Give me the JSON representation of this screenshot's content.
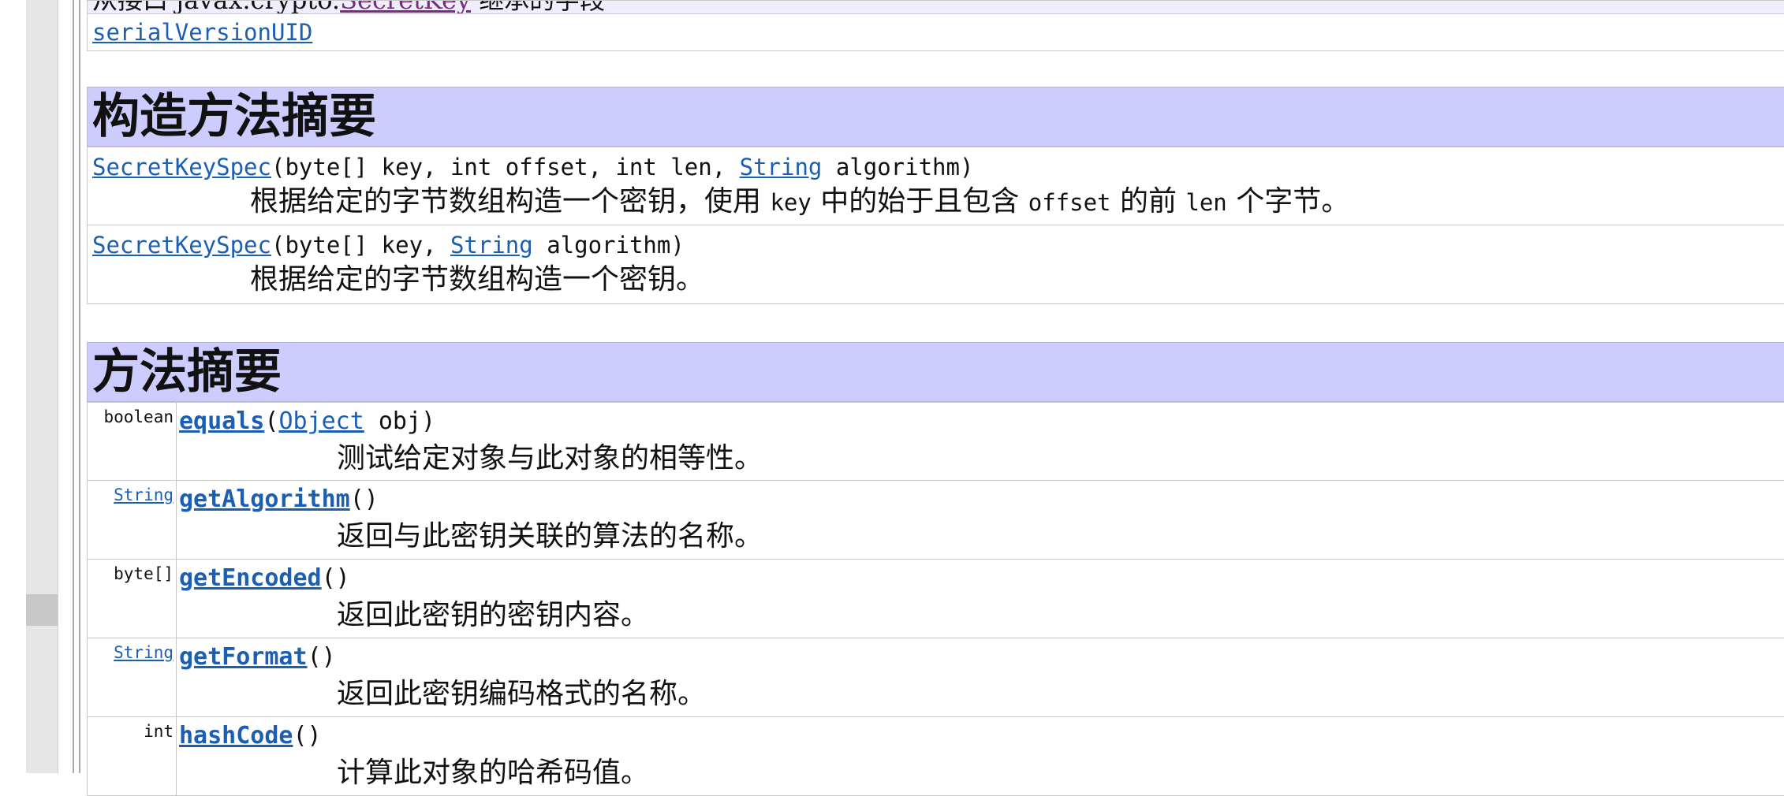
{
  "top_table": {
    "cut_prefix": "从接口 javax.crypto.",
    "cut_link": "SecretKey",
    "cut_suffix": " 继承的字段",
    "field_link": "serialVersionUID"
  },
  "constructor_summary": {
    "title": "构造方法摘要",
    "rows": [
      {
        "name": "SecretKeySpec",
        "params_before": "(byte[] key, int offset, int len, ",
        "param_link": "String",
        "params_after": " algorithm)",
        "desc_1": "根据给定的字节数组构造一个密钥，使用 ",
        "code_1": "key",
        "desc_2": " 中的始于且包含 ",
        "code_2": "offset",
        "desc_3": " 的前 ",
        "code_3": "len",
        "desc_4": " 个字节。"
      },
      {
        "name": "SecretKeySpec",
        "params_before": "(byte[] key, ",
        "param_link": "String",
        "params_after": " algorithm)",
        "desc": "根据给定的字节数组构造一个密钥。"
      }
    ]
  },
  "method_summary": {
    "title": "方法摘要",
    "rows": [
      {
        "type": "boolean",
        "type_is_link": false,
        "name": "equals",
        "open": "(",
        "param_link": "Object",
        "params_after": " obj)",
        "desc": "测试给定对象与此对象的相等性。"
      },
      {
        "type": "String",
        "type_is_link": true,
        "name": "getAlgorithm",
        "params": "()",
        "desc": "返回与此密钥关联的算法的名称。"
      },
      {
        "type": "byte[]",
        "type_is_link": false,
        "name": "getEncoded",
        "params": "()",
        "desc": "返回此密钥的密钥内容。"
      },
      {
        "type": "String",
        "type_is_link": true,
        "name": "getFormat",
        "params": "()",
        "desc": "返回此密钥编码格式的名称。"
      },
      {
        "type": "int",
        "type_is_link": false,
        "name": "hashCode",
        "params": "()",
        "desc": "计算此对象的哈希码值。"
      }
    ]
  },
  "colors": {
    "header_bg": "#ccccff",
    "link": "#1a5fb4",
    "visited_link": "#7a2b7e",
    "border": "#c8c8c8"
  }
}
